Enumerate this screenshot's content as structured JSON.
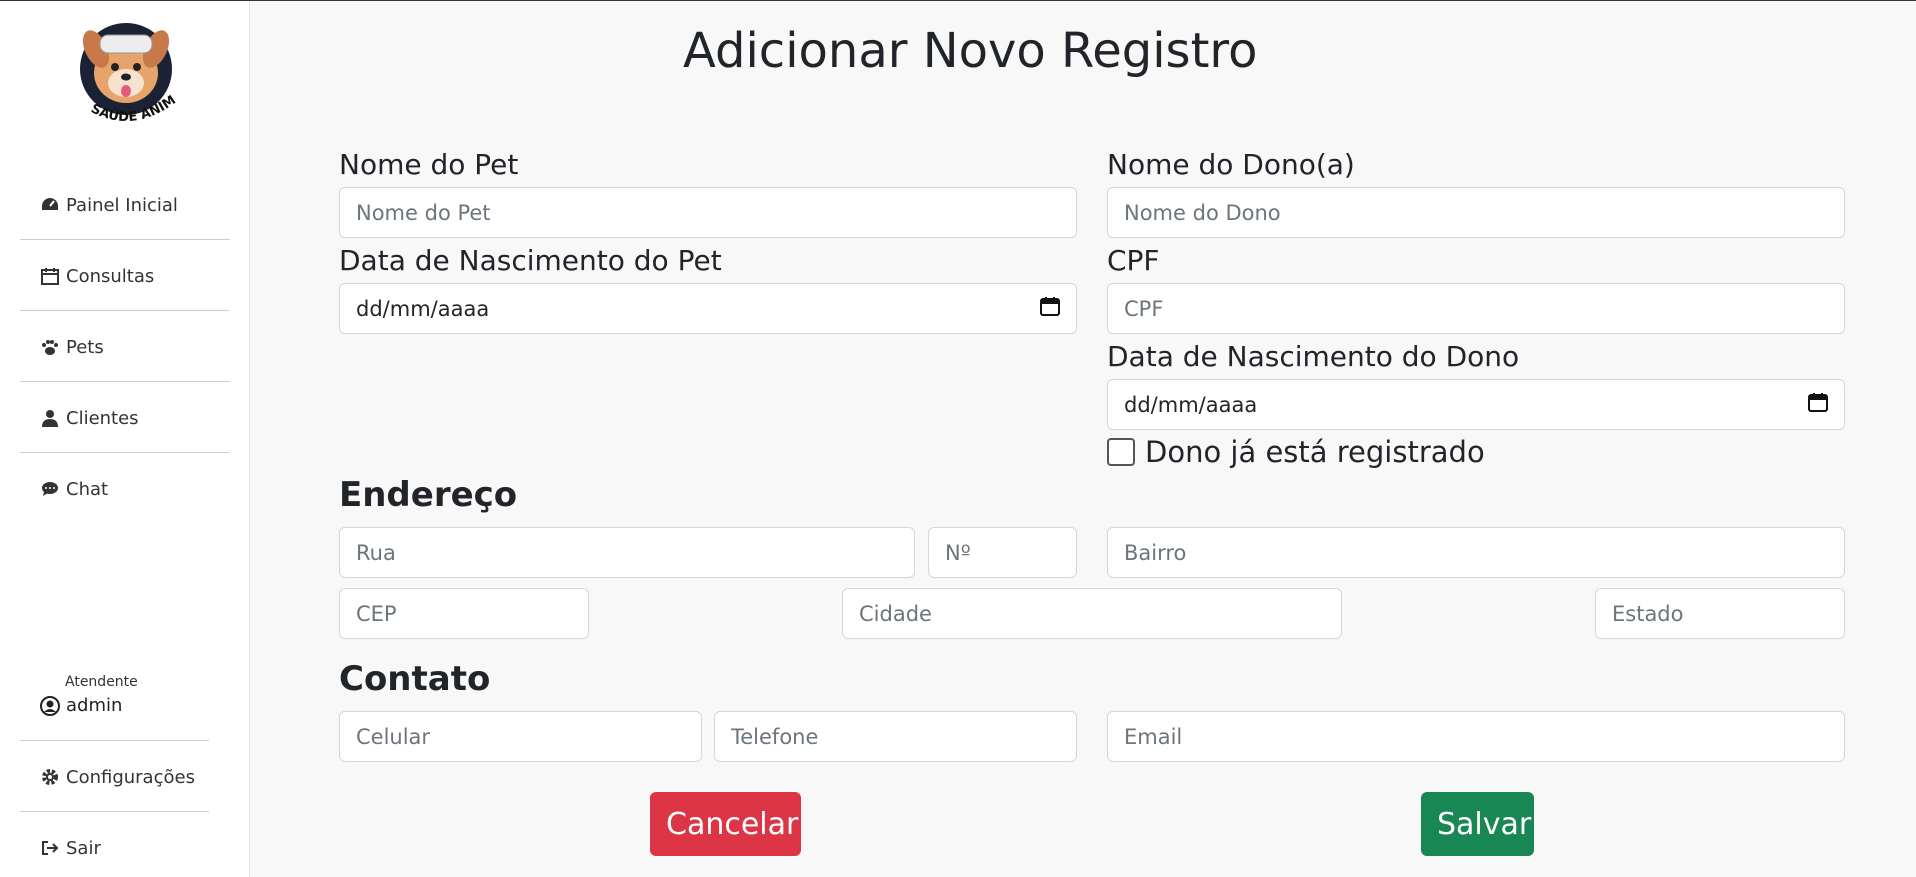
{
  "app": {
    "logo_text": "SAÚDE ANIMAL"
  },
  "sidebar": {
    "items": [
      {
        "label": "Painel Inicial",
        "icon": "dashboard-icon"
      },
      {
        "label": "Consultas",
        "icon": "calendar-icon"
      },
      {
        "label": "Pets",
        "icon": "paw-icon"
      },
      {
        "label": "Clientes",
        "icon": "user-icon"
      },
      {
        "label": "Chat",
        "icon": "chat-icon"
      }
    ],
    "user": {
      "role": "Atendente",
      "name": "admin"
    },
    "bottom_items": [
      {
        "label": "Configurações",
        "icon": "gear-icon"
      },
      {
        "label": "Sair",
        "icon": "sign-out-icon"
      }
    ]
  },
  "form": {
    "title": "Adicionar Novo Registro",
    "pet_name": {
      "label": "Nome do Pet",
      "placeholder": "Nome do Pet",
      "value": ""
    },
    "pet_birth": {
      "label": "Data de Nascimento do Pet",
      "value": "dd/mm/aaaa"
    },
    "owner_name": {
      "label": "Nome do Dono(a)",
      "placeholder": "Nome do Dono",
      "value": ""
    },
    "cpf": {
      "label": "CPF",
      "placeholder": "CPF",
      "value": ""
    },
    "owner_birth": {
      "label": "Data de Nascimento do Dono",
      "value": "dd/mm/aaaa"
    },
    "owner_registered": {
      "label": "Dono já está registrado",
      "checked": false
    },
    "address": {
      "title": "Endereço",
      "rua": {
        "placeholder": "Rua"
      },
      "numero": {
        "placeholder": "Nº"
      },
      "bairro": {
        "placeholder": "Bairro"
      },
      "cep": {
        "placeholder": "CEP"
      },
      "cidade": {
        "placeholder": "Cidade"
      },
      "estado": {
        "placeholder": "Estado"
      }
    },
    "contact": {
      "title": "Contato",
      "celular": {
        "placeholder": "Celular"
      },
      "telefone": {
        "placeholder": "Telefone"
      },
      "email": {
        "placeholder": "Email"
      }
    },
    "cancel_label": "Cancelar",
    "save_label": "Salvar"
  },
  "colors": {
    "cancel": "#dc3545",
    "save": "#198754"
  }
}
